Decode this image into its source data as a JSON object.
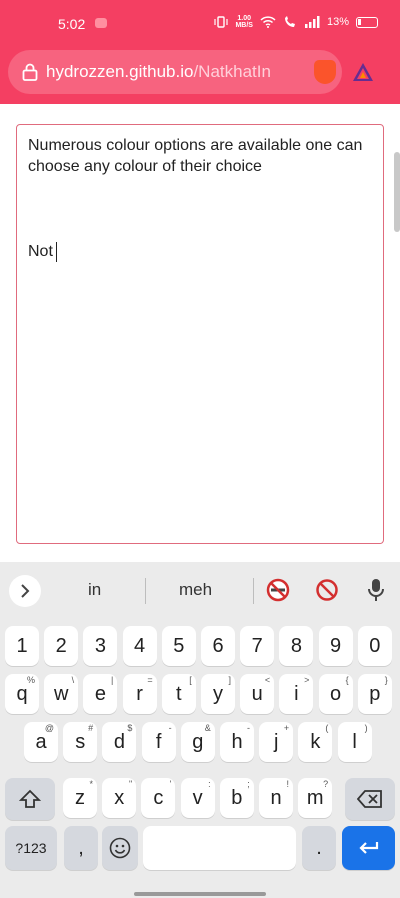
{
  "status_bar": {
    "time": "5:02",
    "speed_top": "1.00",
    "speed_bottom": "MB/S",
    "battery": "13%"
  },
  "browser": {
    "url_host": "hydrozzen.github.io",
    "url_path": "/NatkhatIn"
  },
  "editor": {
    "text_line1": "Numerous colour options are available one can choose any colour of their choice",
    "text_line2": "Not"
  },
  "keyboard": {
    "suggestions": [
      "in",
      "meh"
    ],
    "row_numbers": [
      "1",
      "2",
      "3",
      "4",
      "5",
      "6",
      "7",
      "8",
      "9",
      "0"
    ],
    "row1": [
      {
        "k": "q",
        "h": "%"
      },
      {
        "k": "w",
        "h": "\\"
      },
      {
        "k": "e",
        "h": "|"
      },
      {
        "k": "r",
        "h": "="
      },
      {
        "k": "t",
        "h": "["
      },
      {
        "k": "y",
        "h": "]"
      },
      {
        "k": "u",
        "h": "<"
      },
      {
        "k": "i",
        "h": ">"
      },
      {
        "k": "o",
        "h": "{"
      },
      {
        "k": "p",
        "h": "}"
      }
    ],
    "row2": [
      {
        "k": "a",
        "h": "@"
      },
      {
        "k": "s",
        "h": "#"
      },
      {
        "k": "d",
        "h": "$"
      },
      {
        "k": "f",
        "h": "-"
      },
      {
        "k": "g",
        "h": "&"
      },
      {
        "k": "h",
        "h": "-"
      },
      {
        "k": "j",
        "h": "+"
      },
      {
        "k": "k",
        "h": "("
      },
      {
        "k": "l",
        "h": ")"
      }
    ],
    "row3": [
      {
        "k": "z",
        "h": "*"
      },
      {
        "k": "x",
        "h": "\""
      },
      {
        "k": "c",
        "h": "'"
      },
      {
        "k": "v",
        "h": ":"
      },
      {
        "k": "b",
        "h": ";"
      },
      {
        "k": "n",
        "h": "!"
      },
      {
        "k": "m",
        "h": "?"
      }
    ],
    "symbols_label": "?123",
    "comma_label": ",",
    "period_label": "."
  }
}
